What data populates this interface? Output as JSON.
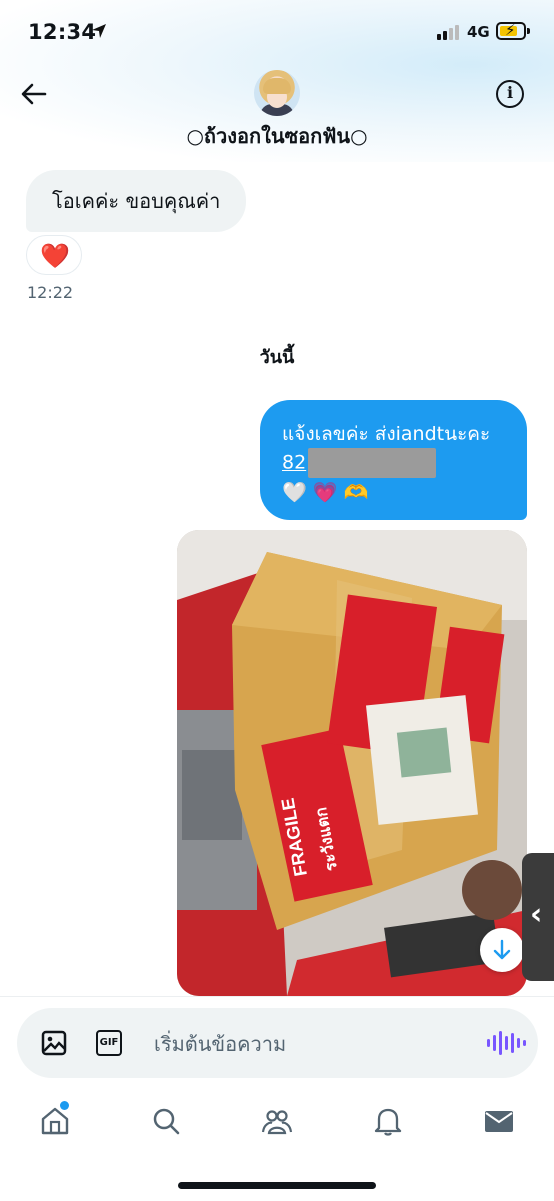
{
  "status_bar": {
    "time": "12:34",
    "network": "4G"
  },
  "header": {
    "contact_name": "○ถ้วงอกในซอกฟัน○"
  },
  "messages": {
    "incoming_text": "โอเคค่ะ ขอบคุณค่า",
    "reaction": "❤️",
    "incoming_time": "12:22",
    "day_separator": "วันนี้",
    "outgoing_line1": "แจ้งเลขค่ะ ส่งiandtนะคะ",
    "outgoing_line2_prefix": "82",
    "outgoing_emoji": [
      "🤍",
      "💗",
      "🫶"
    ]
  },
  "photo": {
    "box_label_en": "FRAGILE",
    "box_label_th": "ระวังแตก"
  },
  "composer": {
    "placeholder": "เริ่มต้นข้อความ"
  },
  "nav": {
    "items": [
      "home-icon",
      "search-icon",
      "communities-icon",
      "notifications-icon",
      "messages-icon"
    ],
    "active": "messages-icon"
  },
  "colors": {
    "accent": "#1d9bf0",
    "voice": "#7856ff",
    "bubble_in": "#eff3f4"
  }
}
